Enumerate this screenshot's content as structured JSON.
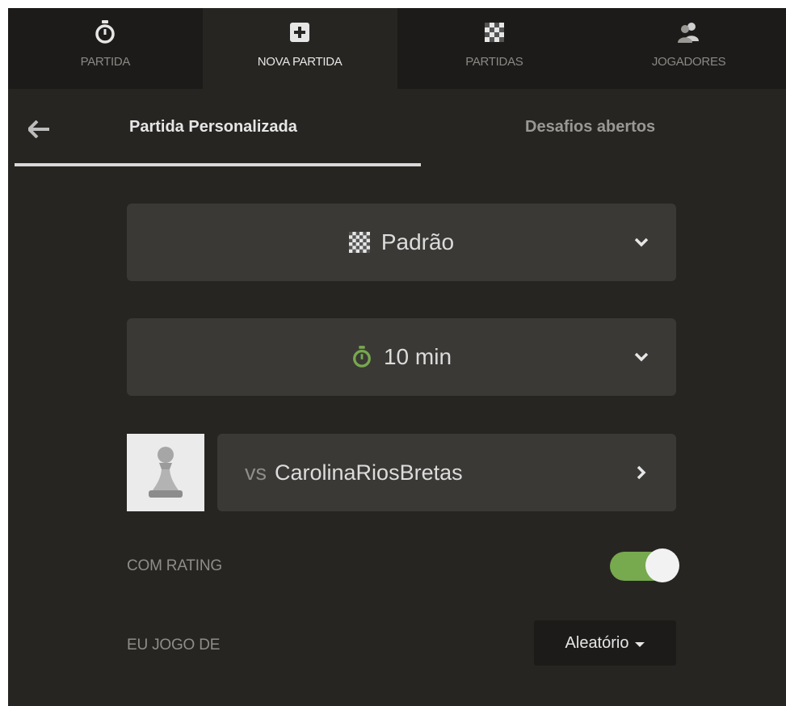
{
  "top_nav": {
    "tabs": [
      {
        "label": "PARTIDA",
        "icon": "stopwatch-icon",
        "active": false
      },
      {
        "label": "NOVA PARTIDA",
        "icon": "plus-square-icon",
        "active": true
      },
      {
        "label": "PARTIDAS",
        "icon": "chessboard-icon",
        "active": false
      },
      {
        "label": "JOGADORES",
        "icon": "users-icon",
        "active": false
      }
    ]
  },
  "sub_tabs": {
    "back_icon": "arrow-left-icon",
    "items": [
      {
        "label": "Partida Personalizada",
        "active": true
      },
      {
        "label": "Desafios abertos",
        "active": false
      }
    ]
  },
  "variant_select": {
    "icon": "chessboard-icon",
    "value": "Padrão"
  },
  "time_select": {
    "icon": "stopwatch-icon",
    "value": "10 min",
    "icon_color": "#77a94f"
  },
  "opponent": {
    "avatar_icon": "pawn-icon",
    "prefix": "vs",
    "name": "CarolinaRiosBretas"
  },
  "rated": {
    "label": "COM RATING",
    "enabled": true,
    "toggle_color": "#77a94f"
  },
  "play_as": {
    "label": "EU JOGO DE",
    "value": "Aleatório"
  },
  "colors": {
    "background": "#272522",
    "nav_background": "#1c1b19",
    "field_background": "#3b3936",
    "accent": "#77a94f"
  }
}
